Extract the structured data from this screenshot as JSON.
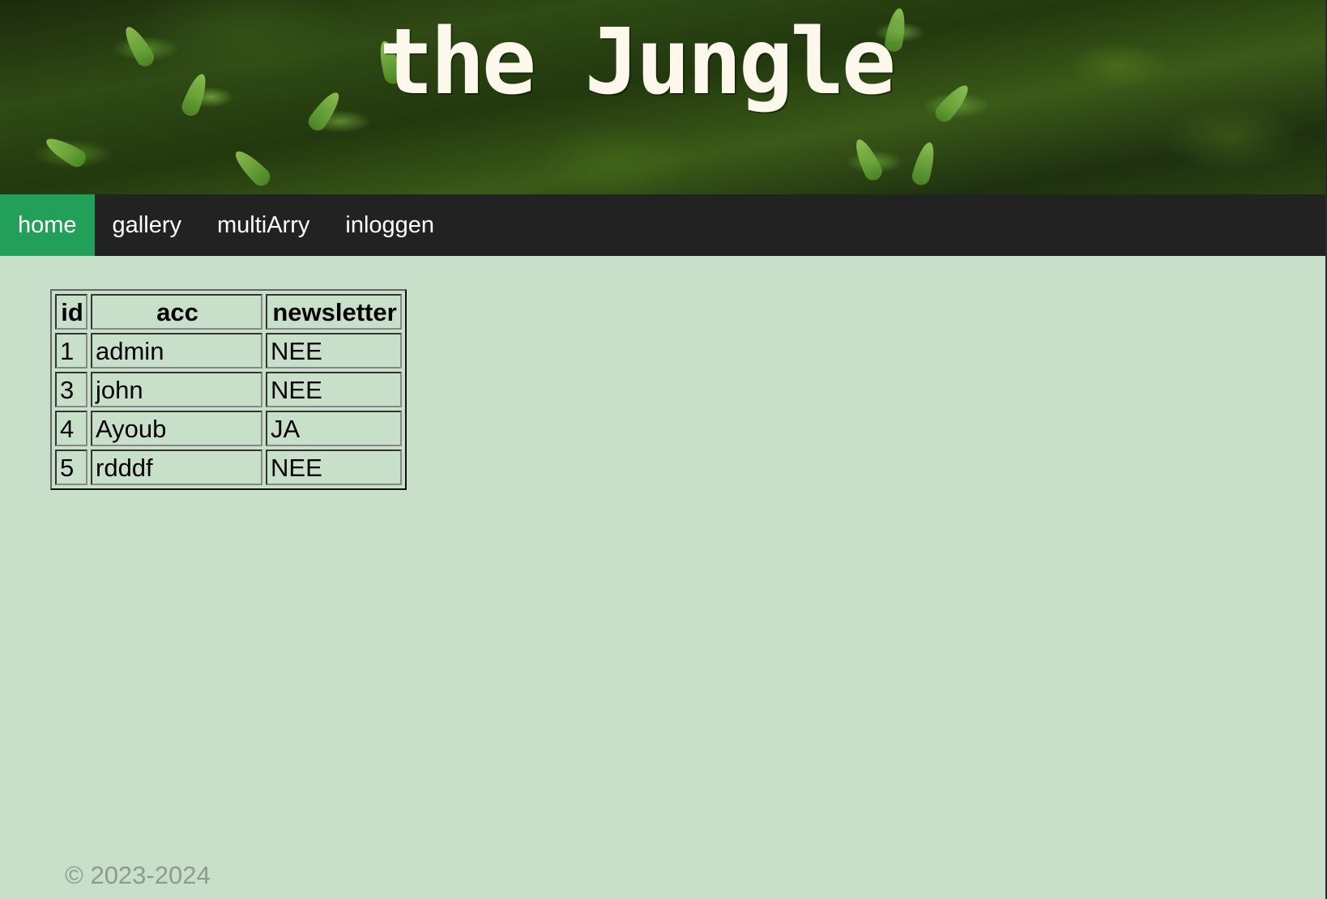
{
  "header": {
    "title": "the Jungle"
  },
  "nav": {
    "items": [
      {
        "label": "home",
        "active": true
      },
      {
        "label": "gallery",
        "active": false
      },
      {
        "label": "multiArry",
        "active": false
      },
      {
        "label": "inloggen",
        "active": false
      }
    ]
  },
  "table": {
    "columns": [
      "id",
      "acc",
      "newsletter"
    ],
    "rows": [
      [
        "1",
        "admin",
        "NEE"
      ],
      [
        "3",
        "john",
        "NEE"
      ],
      [
        "4",
        "Ayoub",
        "JA"
      ],
      [
        "5",
        "rdddf",
        "NEE"
      ]
    ]
  },
  "footer": {
    "text": "© 2023-2024"
  },
  "colors": {
    "page_background": "#c8e0c9",
    "nav_background": "#222222",
    "nav_active": "#22a05a",
    "title_color": "#fdf8ec",
    "footer_text": "#8f9a8f"
  }
}
